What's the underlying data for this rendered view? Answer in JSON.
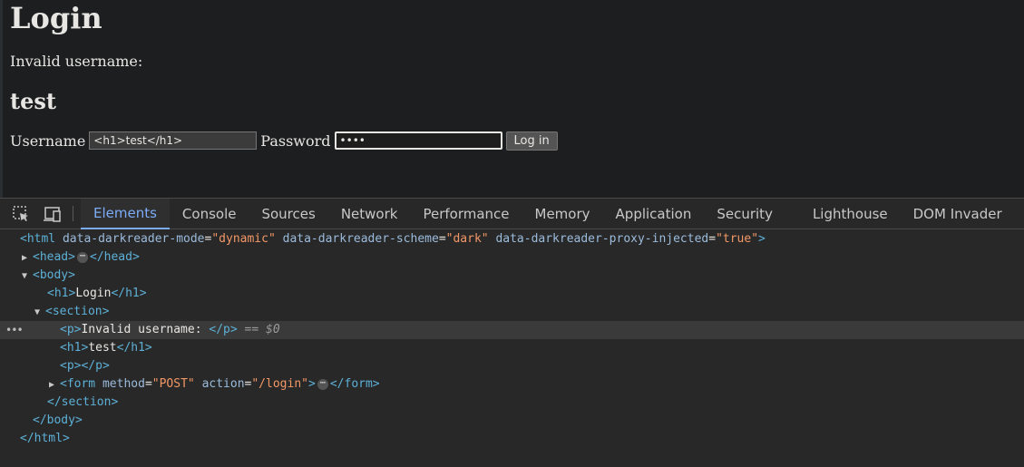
{
  "page": {
    "title": "Login",
    "message": "Invalid username:",
    "injected_heading": "test",
    "form": {
      "username_label": "Username",
      "username_value": "<h1>test</h1>",
      "password_label": "Password",
      "password_value": "test",
      "submit_label": "Log in"
    }
  },
  "devtools": {
    "tabs": [
      "Elements",
      "Console",
      "Sources",
      "Network",
      "Performance",
      "Memory",
      "Application",
      "Security",
      "Lighthouse",
      "DOM Invader"
    ],
    "active_tab": "Elements",
    "icons": {
      "inspect": "inspect-element-icon",
      "device": "device-toolbar-icon"
    },
    "tree": {
      "html_open": "<html",
      "html_attrs": [
        {
          "name": "data-darkreader-mode",
          "value": "\"dynamic\""
        },
        {
          "name": "data-darkreader-scheme",
          "value": "\"dark\""
        },
        {
          "name": "data-darkreader-proxy-injected",
          "value": "\"true\""
        }
      ],
      "gt": ">",
      "head": "<head>",
      "head_close": "</head>",
      "body": "<body>",
      "h1_open": "<h1>",
      "h1_text": "Login",
      "h1_close": "</h1>",
      "section": "<section>",
      "p_open": "<p>",
      "p_text": "Invalid username: ",
      "p_close": "</p>",
      "selected_ref": "== $0",
      "h1b_text": "test",
      "p_empty": "<p></p>",
      "form_open": "<form",
      "form_method_name": "method",
      "form_method_value": "\"POST\"",
      "form_action_name": "action",
      "form_action_value": "\"/login\"",
      "form_close": "</form>",
      "section_close": "</section>",
      "body_close": "</body>",
      "html_close": "</html>",
      "ellipsis": "⋯",
      "row_dots": "•••"
    },
    "colors": {
      "tag": "#5db0d7",
      "attr": "#9bbbdc",
      "value": "#f29766",
      "active_tab": "#7cacf8"
    }
  }
}
